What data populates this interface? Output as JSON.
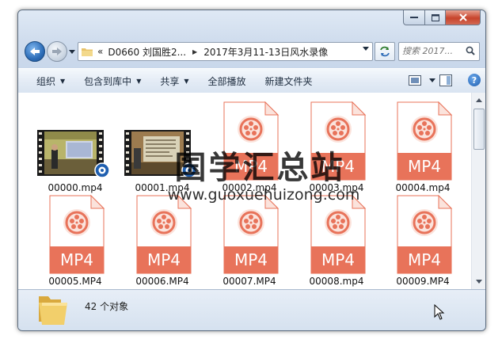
{
  "window": {
    "caption_buttons": [
      "minimize",
      "maximize",
      "close"
    ]
  },
  "nav": {
    "breadcrumb_overflow": "«",
    "breadcrumb": [
      "D0660 刘国胜2...",
      "2017年3月11-13日风水录像"
    ],
    "search_placeholder": "搜索 2017...",
    "icons": {
      "back": "back-arrow-icon",
      "forward": "forward-arrow-icon",
      "refresh": "refresh-icon",
      "search": "magnifier-icon"
    }
  },
  "toolbar": {
    "organize": "组织",
    "include_in_library": "包含到库中",
    "share": "共享",
    "play_all": "全部播放",
    "new_folder": "新建文件夹",
    "help": "?"
  },
  "files": [
    {
      "name": "00000.mp4",
      "kind": "video-thumb"
    },
    {
      "name": "00001.mp4",
      "kind": "video-thumb"
    },
    {
      "name": "00002.mp4",
      "kind": "mp4-icon"
    },
    {
      "name": "00003.mp4",
      "kind": "mp4-icon"
    },
    {
      "name": "00004.mp4",
      "kind": "mp4-icon"
    },
    {
      "name": "00005.MP4",
      "kind": "mp4-icon"
    },
    {
      "name": "00006.MP4",
      "kind": "mp4-icon"
    },
    {
      "name": "00007.MP4",
      "kind": "mp4-icon"
    },
    {
      "name": "00008.mp4",
      "kind": "mp4-icon"
    },
    {
      "name": "00009.MP4",
      "kind": "mp4-icon"
    }
  ],
  "mp4_badge_text": "MP4",
  "watermark": {
    "title": "国学汇总站",
    "url": "www.guoxuehuizong.com"
  },
  "status": {
    "count": "42 个对象"
  },
  "colors": {
    "mp4_orange": "#e8735a",
    "mp4_light": "#fbe3dc",
    "accent_blue": "#2d6db8"
  }
}
